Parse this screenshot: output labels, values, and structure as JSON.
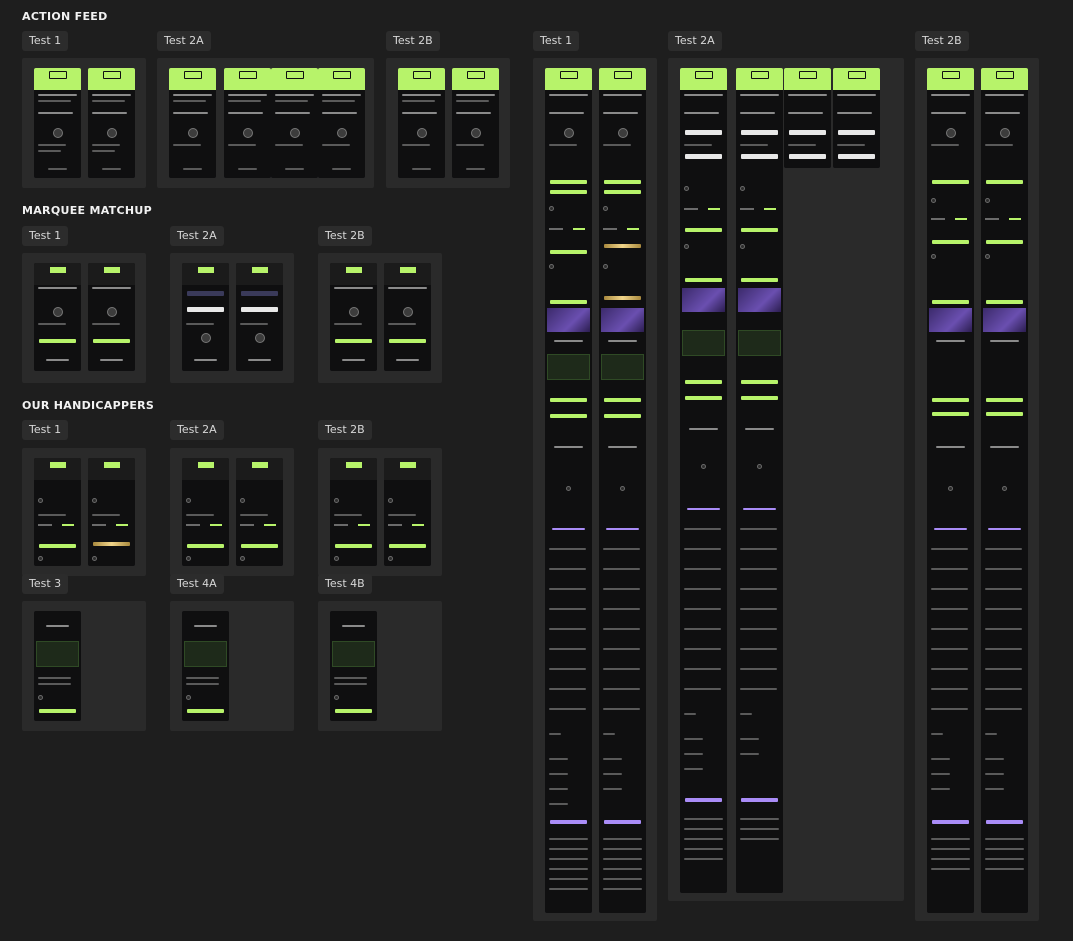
{
  "sections": {
    "action_feed": "ACTION FEED",
    "marquee_matchup": "MARQUEE MATCHUP",
    "our_handicappers": "OUR HANDICAPPERS"
  },
  "chips": {
    "af_test1": "Test 1",
    "af_test2a": "Test 2A",
    "af_test2b": "Test 2B",
    "full_test1": "Test 1",
    "full_test2a": "Test 2A",
    "full_test2b": "Test 2B",
    "mm_test1": "Test 1",
    "mm_test2a": "Test 2A",
    "mm_test2b": "Test 2B",
    "oh_test1": "Test 1",
    "oh_test2a": "Test 2A",
    "oh_test2b": "Test 2B",
    "oh_test3": "Test 3",
    "oh_test4a": "Test 4A",
    "oh_test4b": "Test 4B"
  },
  "colors": {
    "canvas_bg": "#1e1e1e",
    "panel_bg": "#2a2a2a",
    "chip_bg": "#2c2c2c",
    "accent_green": "#b7f36a",
    "accent_purple": "#a98cf7",
    "phone_bg": "#0f0f10"
  }
}
